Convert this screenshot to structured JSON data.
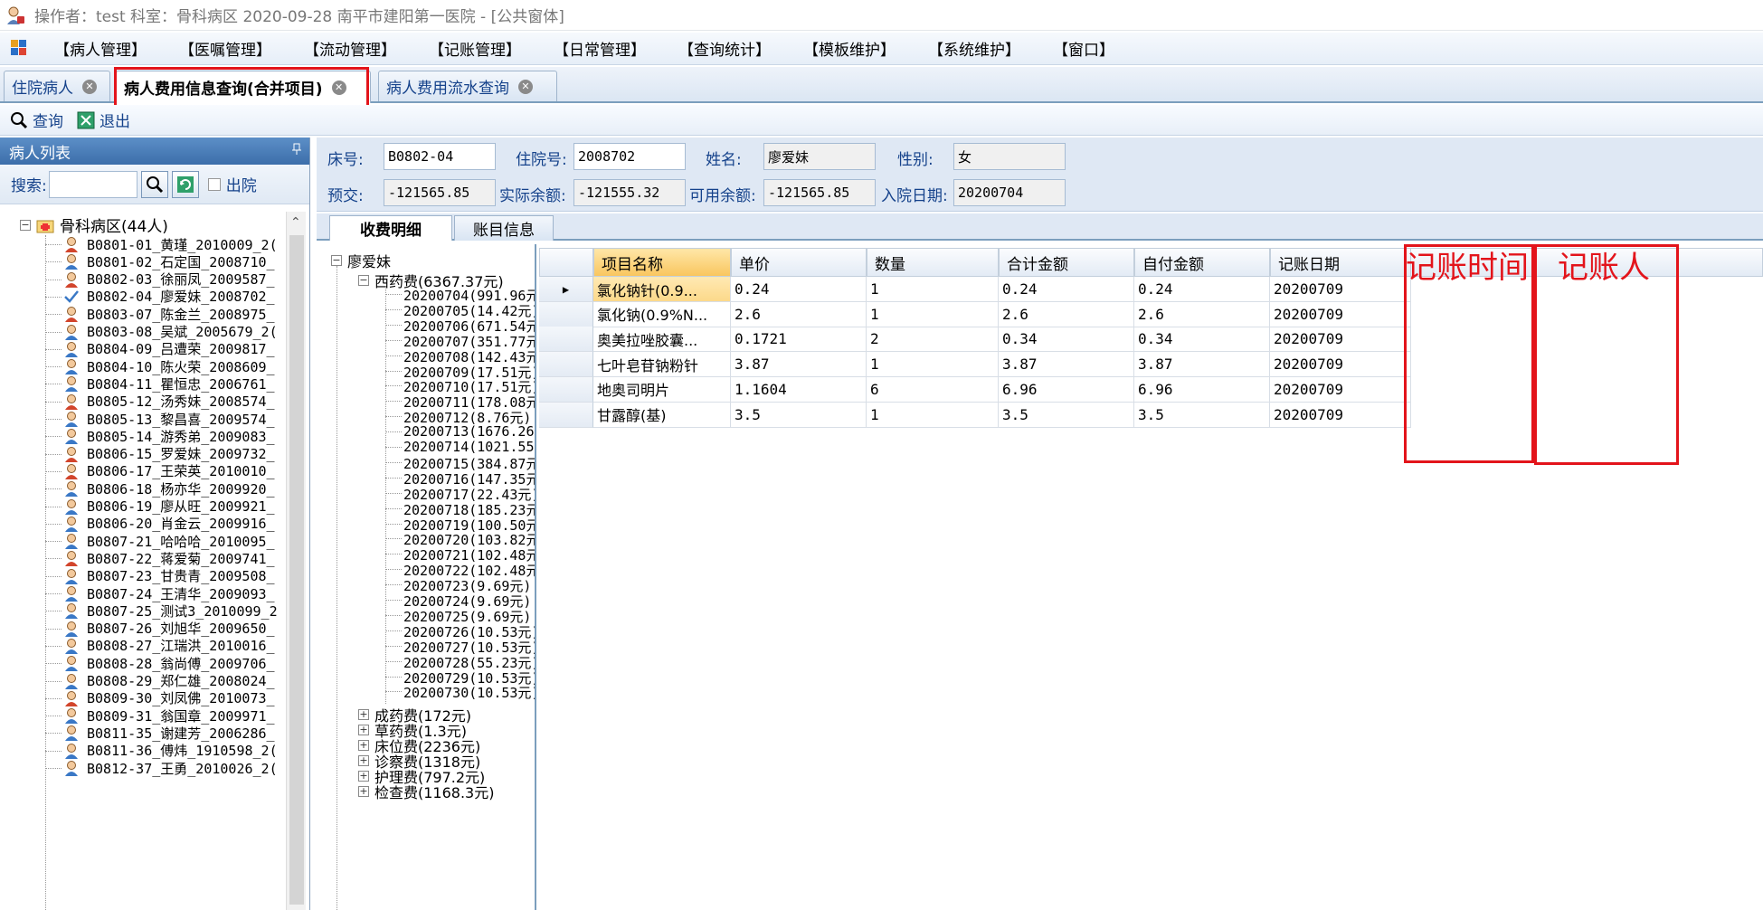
{
  "window": {
    "title": "操作者：test  科室：骨科病区  2020-09-28  南平市建阳第一医院 - [公共窗体]"
  },
  "menu": [
    "【病人管理】",
    "【医嘱管理】",
    "【流动管理】",
    "【记账管理】",
    "【日常管理】",
    "【查询统计】",
    "【模板维护】",
    "【系统维护】",
    "【窗口】"
  ],
  "tabs": [
    {
      "label": "住院病人"
    },
    {
      "label": "病人费用信息查询(合并项目)"
    },
    {
      "label": "病人费用流水查询"
    }
  ],
  "toolbar": {
    "query_label": "查询",
    "exit_label": "退出"
  },
  "left_panel": {
    "title": "病人列表",
    "pin": "ꟸ",
    "search_label": "搜索:",
    "search_value": "",
    "discharged_label": "出院",
    "root_label": "骨科病区(44人)",
    "patients": [
      "B0801-01_黄瑾_2010009_2(",
      "B0801-02_石定国_2008710_",
      "B0802-03_徐丽凤_2009587_",
      "B0802-04_廖爱妹_2008702_",
      "B0803-07_陈金兰_2008975_",
      "B0803-08_吴斌_2005679_2(",
      "B0804-09_吕遭荣_2009817_",
      "B0804-10_陈火荣_2008609_",
      "B0804-11_瞿恒忠_2006761_",
      "B0805-12_汤秀妹_2008574_",
      "B0805-13_黎昌喜_2009574_",
      "B0805-14_游秀弟_2009083_",
      "B0806-15_罗爱妹_2009732_",
      "B0806-17_王荣英_2010010_",
      "B0806-18_杨亦华_2009920_",
      "B0806-19_廖从旺_2009921_",
      "B0806-20_肖金云_2009916_",
      "B0807-21_哈哈哈_2010095_",
      "B0807-22_蒋爱菊_2009741_",
      "B0807-23_甘贵青_2009508_",
      "B0807-24_王清华_2009093_",
      "B0807-25_测试3_2010099_2",
      "B0807-26_刘旭华_2009650_",
      "B0808-27_江瑞洪_2010016_",
      "B0808-28_翁尚傅_2009706_",
      "B0808-29_郑仁雄_2008024_",
      "B0809-30_刘凤佛_2010073_",
      "B0809-31_翁国章_2009971_",
      "B0811-35_谢建芳_2006286_",
      "B0811-36_傅炜_1910598_2(",
      "B0812-37_王勇_2010026_2("
    ],
    "patient_gender": [
      "f",
      "m",
      "f",
      "sel",
      "f",
      "m",
      "m",
      "m",
      "m",
      "f",
      "m",
      "m",
      "f",
      "f",
      "m",
      "m",
      "m",
      "m",
      "f",
      "m",
      "m",
      "m",
      "m",
      "m",
      "m",
      "m",
      "f",
      "m",
      "m",
      "m",
      "m"
    ]
  },
  "info": {
    "bed_label": "床号:",
    "bed": "B0802-04",
    "inpatient_label": "住院号:",
    "inpatient": "2008702",
    "name_label": "姓名:",
    "name": "廖爱妹",
    "sex_label": "性别:",
    "sex": "女",
    "prepay_label": "预交:",
    "prepay": "-121565.85",
    "balance_label": "实际余额:",
    "balance": "-121555.32",
    "avail_label": "可用余额:",
    "avail": "-121565.85",
    "admit_label": "入院日期:",
    "admit": "20200704"
  },
  "subtabs": [
    "收费明细",
    "账目信息"
  ],
  "fee_tree": {
    "root": "廖爱妹",
    "western": "西药费(6367.37元)",
    "dates": [
      "20200704(991.96元",
      "20200705(14.42元)",
      "20200706(671.54元",
      "20200707(351.77元",
      "20200708(142.43元",
      "20200709(17.51元)",
      "20200710(17.51元)",
      "20200711(178.08元",
      "20200712(8.76元)",
      "20200713(1676.26",
      "20200714(1021.55",
      "20200715(384.87元",
      "20200716(147.35元",
      "20200717(22.43元)",
      "20200718(185.23元",
      "20200719(100.50元",
      "20200720(103.82元",
      "20200721(102.48元",
      "20200722(102.48元",
      "20200723(9.69元)",
      "20200724(9.69元)",
      "20200725(9.69元)",
      "20200726(10.53元)",
      "20200727(10.53元)",
      "20200728(55.23元)",
      "20200729(10.53元)",
      "20200730(10.53元)"
    ],
    "others": [
      "成药费(172元)",
      "草药费(1.3元)",
      "床位费(2236元)",
      "诊察费(1318元)",
      "护理费(797.2元)",
      "检查费(1168.3元)"
    ]
  },
  "grid": {
    "headers": [
      "项目名称",
      "单价",
      "数量",
      "合计金额",
      "自付金额",
      "记账日期"
    ],
    "rows": [
      [
        "氯化钠针(0.9...",
        "0.24",
        "1",
        "0.24",
        "0.24",
        "20200709"
      ],
      [
        "氯化钠(0.9%N...",
        "2.6",
        "1",
        "2.6",
        "2.6",
        "20200709"
      ],
      [
        "奥美拉唑胶囊...",
        "0.1721",
        "2",
        "0.34",
        "0.34",
        "20200709"
      ],
      [
        "七叶皂苷钠粉针",
        "3.87",
        "1",
        "3.87",
        "3.87",
        "20200709"
      ],
      [
        "地奥司明片",
        "1.1604",
        "6",
        "6.96",
        "6.96",
        "20200709"
      ],
      [
        "甘露醇(基)",
        "3.5",
        "1",
        "3.5",
        "3.5",
        "20200709"
      ]
    ]
  },
  "annotations": {
    "col_time": "记账时间",
    "col_person": "记账人"
  },
  "colors": {
    "highlight": "#e3141b",
    "header_blue": "#3c6eaa",
    "link_blue": "#15428b"
  }
}
